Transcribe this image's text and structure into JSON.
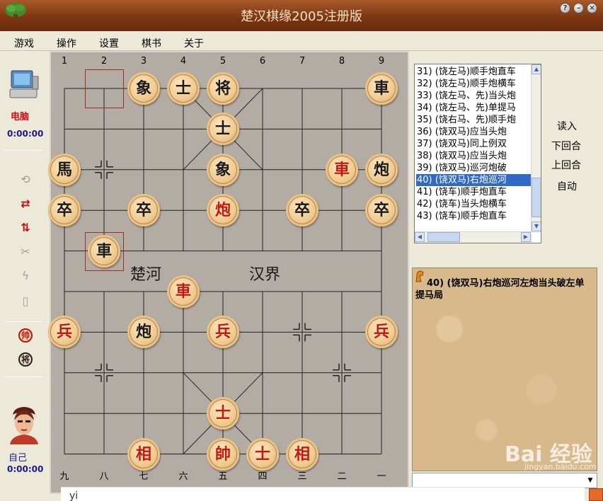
{
  "window": {
    "title": "楚汉棋缘2005注册版",
    "help": "?",
    "minimize": "–",
    "close": "×"
  },
  "menu": [
    {
      "label": "游戏"
    },
    {
      "label": "操作"
    },
    {
      "label": "设置"
    },
    {
      "label": "棋书"
    },
    {
      "label": "关于"
    }
  ],
  "left_panel": {
    "computer_label": "电脑",
    "computer_time": "0:00:00",
    "self_label": "自己",
    "self_time": "0:00:00",
    "red_general": "帅",
    "black_general": "将"
  },
  "board": {
    "top_coords": [
      "1",
      "2",
      "3",
      "4",
      "5",
      "6",
      "7",
      "8",
      "9"
    ],
    "bottom_coords": [
      "九",
      "八",
      "七",
      "六",
      "五",
      "四",
      "三",
      "二",
      "一"
    ],
    "river_left": "楚河",
    "river_right": "汉界",
    "pieces": [
      {
        "char": "象",
        "side": "black",
        "file": 2,
        "rank": 0
      },
      {
        "char": "士",
        "side": "black",
        "file": 3,
        "rank": 0
      },
      {
        "char": "将",
        "side": "black",
        "file": 4,
        "rank": 0
      },
      {
        "char": "車",
        "side": "black",
        "file": 8,
        "rank": 0
      },
      {
        "char": "士",
        "side": "black",
        "file": 4,
        "rank": 1
      },
      {
        "char": "馬",
        "side": "black",
        "file": 0,
        "rank": 2
      },
      {
        "char": "象",
        "side": "black",
        "file": 4,
        "rank": 2
      },
      {
        "char": "車",
        "side": "red",
        "file": 7,
        "rank": 2
      },
      {
        "char": "炮",
        "side": "black",
        "file": 8,
        "rank": 2
      },
      {
        "char": "卒",
        "side": "black",
        "file": 0,
        "rank": 3
      },
      {
        "char": "卒",
        "side": "black",
        "file": 2,
        "rank": 3
      },
      {
        "char": "炮",
        "side": "red",
        "file": 4,
        "rank": 3
      },
      {
        "char": "卒",
        "side": "black",
        "file": 6,
        "rank": 3
      },
      {
        "char": "卒",
        "side": "black",
        "file": 8,
        "rank": 3
      },
      {
        "char": "車",
        "side": "black",
        "file": 1,
        "rank": 4
      },
      {
        "char": "車",
        "side": "red",
        "file": 3,
        "rank": 5
      },
      {
        "char": "兵",
        "side": "red",
        "file": 0,
        "rank": 6
      },
      {
        "char": "炮",
        "side": "black",
        "file": 2,
        "rank": 6
      },
      {
        "char": "兵",
        "side": "red",
        "file": 4,
        "rank": 6
      },
      {
        "char": "兵",
        "side": "red",
        "file": 8,
        "rank": 6
      },
      {
        "char": "士",
        "side": "red",
        "file": 4,
        "rank": 8
      },
      {
        "char": "相",
        "side": "red",
        "file": 2,
        "rank": 9
      },
      {
        "char": "帥",
        "side": "red",
        "file": 4,
        "rank": 9
      },
      {
        "char": "士",
        "side": "red",
        "file": 5,
        "rank": 9
      },
      {
        "char": "相",
        "side": "red",
        "file": 6,
        "rank": 9
      }
    ],
    "selection_boxes": [
      {
        "file": 1,
        "rank": 0
      },
      {
        "file": 1,
        "rank": 4
      }
    ]
  },
  "move_list": {
    "items": [
      "31) (饶左马)顺手炮直车",
      "32) (饶左马)顺手炮横车",
      "33) (饶左马、先)当头炮",
      "34) (饶左马、先)单提马",
      "35) (饶右马、先)顺手炮",
      "36) (饶双马)应当头炮",
      "37) (饶双马)同上例双",
      "38) (饶双马)应当头炮",
      "39) (饶双马)巡河炮破",
      "40) (饶双马)右炮巡河",
      "41) (饶车)顺手炮直车",
      "42) (饶车)当头炮横车",
      "43) (饶车)顺手炮直车"
    ],
    "selected_index": 9
  },
  "controls": {
    "load": "读入",
    "next": "下回合",
    "prev": "上回合",
    "auto": "自动"
  },
  "comment": {
    "text": "40) (饶双马)右炮巡河左炮当头破左单提马局",
    "watermark": "Bai 经验",
    "watermark_sub": "jingyan.baidu.com"
  },
  "ime": {
    "text": "yi"
  }
}
